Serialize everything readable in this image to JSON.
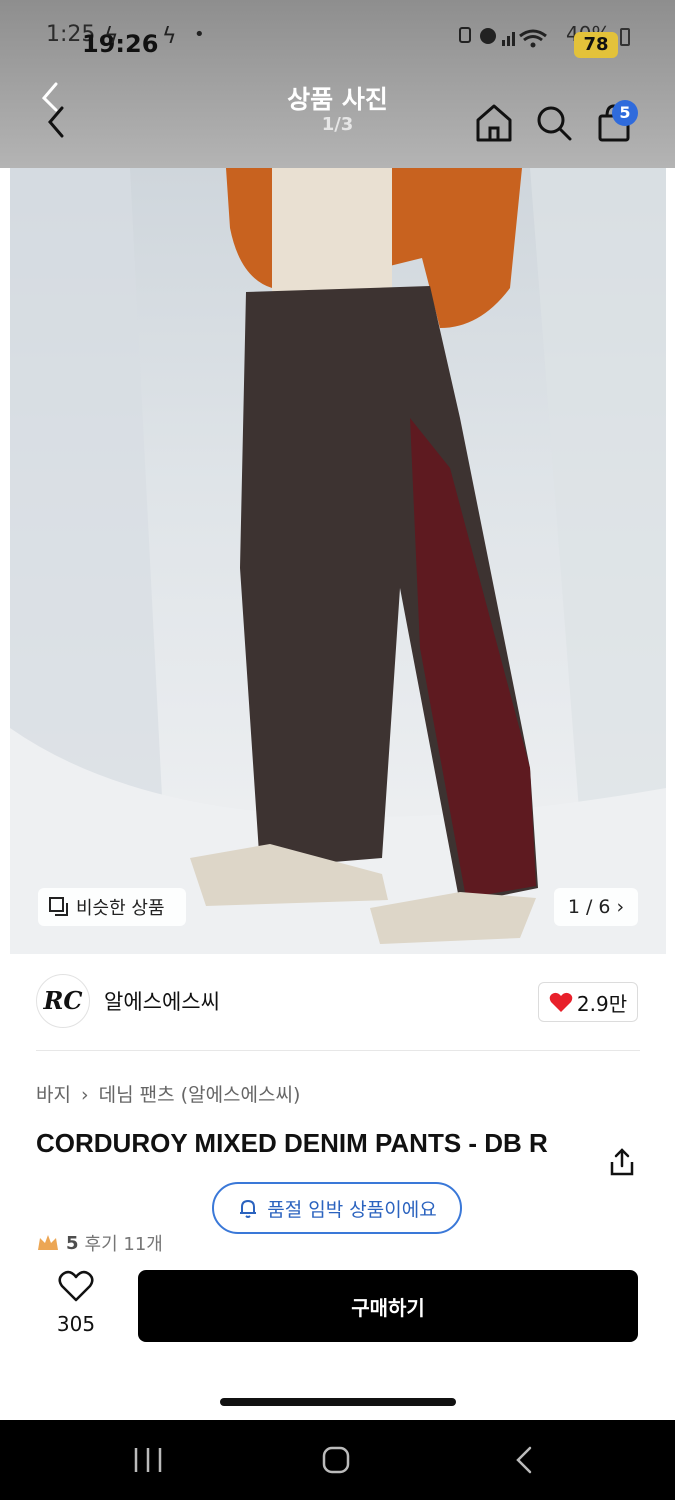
{
  "status_bar": {
    "time_behind": "1:25",
    "time_front": "19:26",
    "battery_percent": "40%",
    "battery_badge": "78"
  },
  "header": {
    "title": "상품 사진",
    "page_indicator": "1/3",
    "cart_count": "5",
    "icons": [
      "back-icon",
      "home-icon",
      "search-icon",
      "shopping-bag-icon"
    ]
  },
  "photo": {
    "similar_label": "비슷한 상품",
    "page_counter": "1 / 6"
  },
  "store": {
    "logo_text": "RC",
    "name": "알에스에스씨",
    "likes": "2.9만"
  },
  "product": {
    "breadcrumb": [
      "바지",
      "데님 팬츠 (알에스에스씨)"
    ],
    "title": "CORDUROY MIXED DENIM PANTS - DB R",
    "soldout_notice": "품절 임박 상품이에요",
    "rating": "5",
    "reviews": "후기 11개"
  },
  "action_bar": {
    "wish_count": "305",
    "buy_label": "구매하기"
  },
  "colors": {
    "accent_blue": "#2f6bdc",
    "heart_red": "#e8202a",
    "buy_button": "#000000"
  }
}
